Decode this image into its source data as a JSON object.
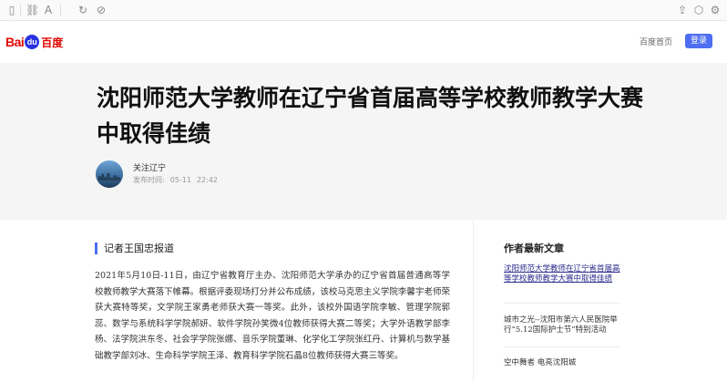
{
  "header": {
    "logo_bai": "Bai",
    "logo_du": "du",
    "logo_cn": "百度",
    "home_link": "百度首页",
    "login": "登录"
  },
  "article": {
    "title": "沈阳师范大学教师在辽宁省首届高等学校教师教学大赛中取得佳绩",
    "author": "关注辽宁",
    "publish_label": "发布时间:",
    "publish_date": "05-11",
    "publish_time": "22:42",
    "section_heading": "记者王国忠报道",
    "paragraph": "2021年5月10日-11日，由辽宁省教育厅主办、沈阳师范大学承办的辽宁省首届普通高等学校教师教学大赛落下帷幕。根据评委现场打分并公布成绩，该校马克思主义学院李馨宇老师荣获大赛特等奖，文学院王家勇老师获大赛一等奖。此外，该校外国语学院李敏、管理学院郭蕊、数学与系统科学学院郝妍、软件学院孙笑微4位教师获得大赛二等奖；大学外语教学部李杨、法学院洪东冬、社会学学院张娜、音乐学院董琳、化学化工学院张红丹、计算机与数学基础教学部刘冰、生命科学学院王泽、教育科学学院石晶8位教师获得大赛三等奖。"
  },
  "sidebar": {
    "title": "作者最新文章",
    "items": [
      "沈阳师范大学教师在辽宁省首届高等学校教师教学大赛中取得佳绩",
      "城市之光--沈阳市第六人民医院举行“5.12国际护士节”特别活动",
      "空中舞者 电亮沈阳城"
    ]
  }
}
